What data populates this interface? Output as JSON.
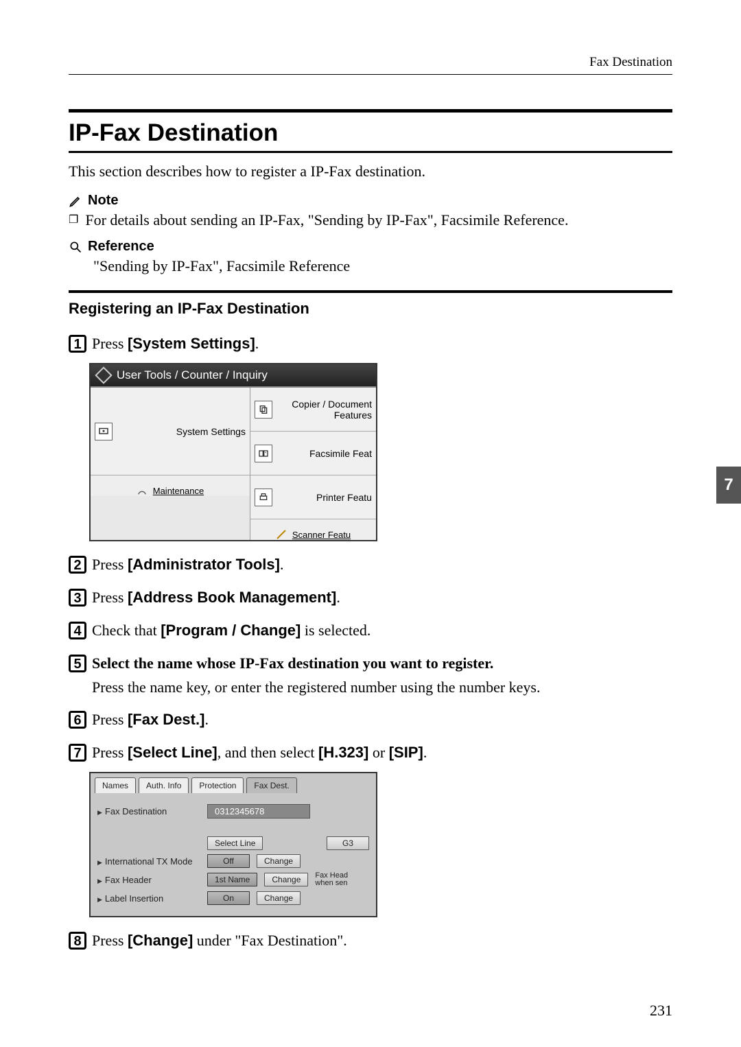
{
  "header": {
    "right": "Fax Destination"
  },
  "title": "IP-Fax Destination",
  "intro": "This section describes how to register a IP-Fax destination.",
  "note": {
    "label": "Note",
    "text": "For details about sending an IP-Fax, \"Sending by IP-Fax\", Facsimile Reference."
  },
  "reference": {
    "label": "Reference",
    "text": "\"Sending by IP-Fax\", Facsimile Reference"
  },
  "subheading": "Registering an IP-Fax Destination",
  "steps": {
    "s1": {
      "pre": "Press ",
      "bold": "[System Settings]",
      "post": "."
    },
    "s2": {
      "pre": "Press ",
      "bold": "[Administrator Tools]",
      "post": "."
    },
    "s3": {
      "pre": "Press ",
      "bold": "[Address Book Management]",
      "post": "."
    },
    "s4": {
      "pre": "Check that ",
      "bold": "[Program / Change]",
      "post": " is selected."
    },
    "s5": {
      "line": "Select the name whose IP-Fax destination you want to register.",
      "sub": "Press the name key, or enter the registered number using the number keys."
    },
    "s6": {
      "pre": "Press ",
      "bold": "[Fax Dest.]",
      "post": "."
    },
    "s7": {
      "pre": "Press ",
      "b1": "[Select Line]",
      "mid": ", and then select ",
      "b2": "[H.323]",
      "mid2": " or ",
      "b3": "[SIP]",
      "post": "."
    },
    "s8": {
      "pre": "Press ",
      "bold": "[Change]",
      "post": " under \"Fax Destination\"."
    }
  },
  "shot1": {
    "title": "User Tools / Counter / Inquiry",
    "left": {
      "system": "System Settings",
      "maintenance": "Maintenance"
    },
    "right": {
      "copier": "Copier / Document Features",
      "fax": "Facsimile Feat",
      "printer": "Printer Featu",
      "scanner": "Scanner Featu"
    }
  },
  "shot2": {
    "tabs": {
      "names": "Names",
      "auth": "Auth. Info",
      "protection": "Protection",
      "faxdest": "Fax Dest."
    },
    "rows": {
      "faxdest_label": "Fax Destination",
      "faxdest_value": "0312345678",
      "selectline": "Select Line",
      "g3": "G3",
      "intl_label": "International TX Mode",
      "off": "Off",
      "change": "Change",
      "header_label": "Fax Header",
      "firstname": "1st Name",
      "header_side": "Fax Head when sen",
      "label_insertion": "Label Insertion",
      "on": "On"
    }
  },
  "chapter": "7",
  "page_number": "231"
}
